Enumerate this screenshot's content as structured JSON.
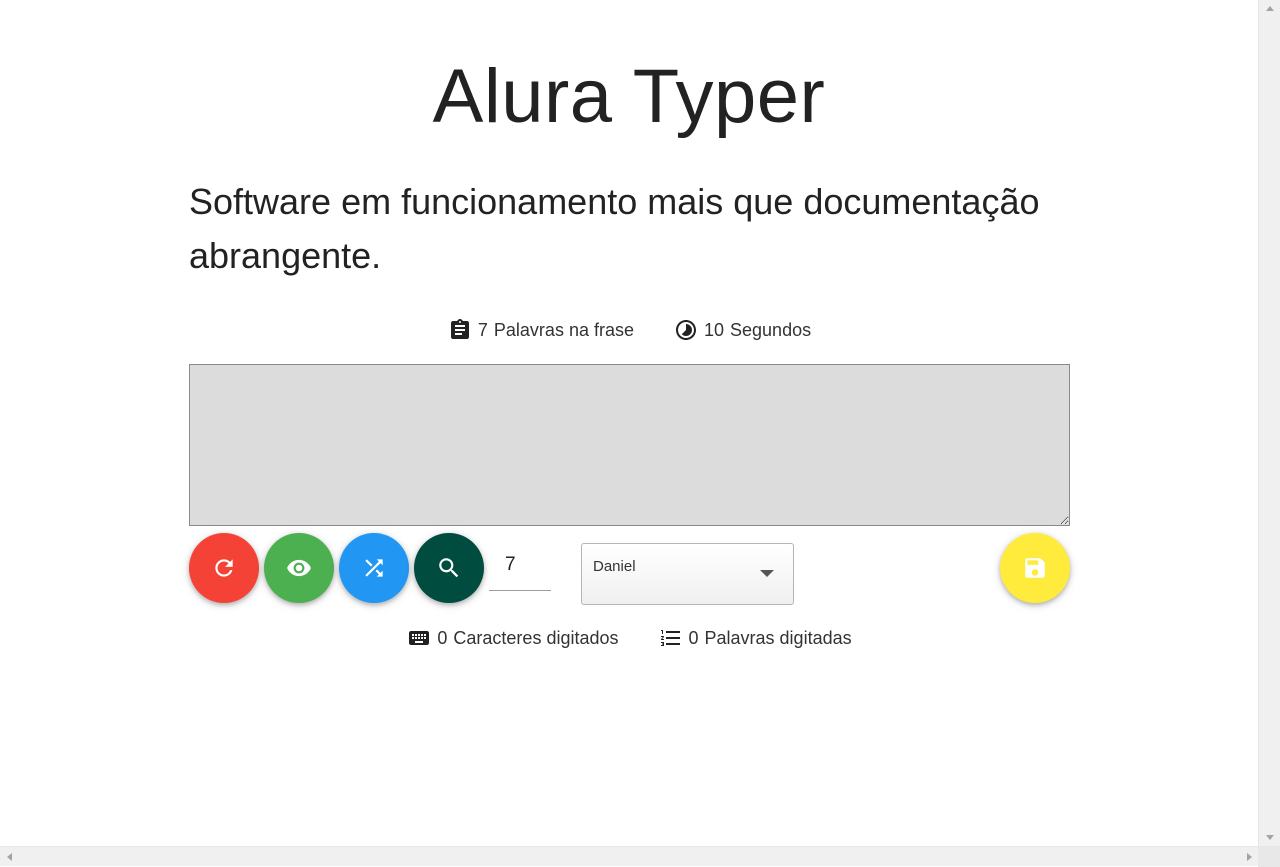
{
  "app": {
    "title": "Alura Typer",
    "phrase": "Software em funcionamento mais que documentação abrangente."
  },
  "stats_top": {
    "words_count": "7",
    "words_label": "Palavras na frase",
    "time_count": "10",
    "time_label": "Segundos"
  },
  "typing_area": {
    "value": ""
  },
  "controls": {
    "phrase_id_value": "7",
    "user_select_value": "Daniel"
  },
  "stats_bottom": {
    "chars_count": "0",
    "chars_label": "Caracteres digitados",
    "words_count": "0",
    "words_label": "Palavras digitadas"
  },
  "icons": {
    "words": "assignment-icon",
    "time": "timelapse-icon",
    "restart": "restart-icon",
    "show": "visibility-icon",
    "random": "shuffle-icon",
    "search": "search-icon",
    "save": "save-icon",
    "chars": "keyboard-icon",
    "typed_words": "format-list-numbered-icon"
  },
  "colors": {
    "restart_button": "#f44336",
    "show_button": "#4caf50",
    "random_button": "#2196f3",
    "search_button": "#004d40",
    "save_button": "#ffeb3b",
    "typing_area_bg": "#dcdcdc"
  }
}
